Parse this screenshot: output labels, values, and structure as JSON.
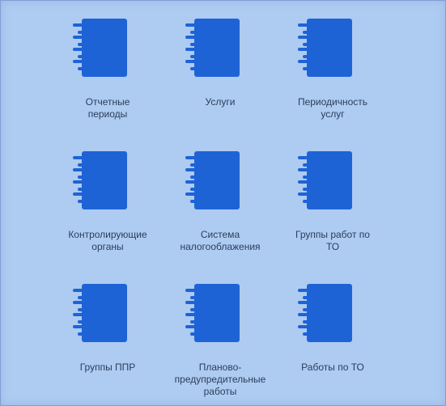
{
  "colors": {
    "background": "#aecbf1",
    "icon": "#1e63d6",
    "text": "#2a3e5c"
  },
  "tiles": [
    {
      "icon": "notebook-icon",
      "label": "Отчетные\nпериоды"
    },
    {
      "icon": "notebook-icon",
      "label": "Услуги"
    },
    {
      "icon": "notebook-icon",
      "label": "Периодичность\nуслуг"
    },
    {
      "icon": "notebook-icon",
      "label": "Контролирующие\nорганы"
    },
    {
      "icon": "notebook-icon",
      "label": "Система\nналогооблажения"
    },
    {
      "icon": "notebook-icon",
      "label": "Группы работ по\nТО"
    },
    {
      "icon": "notebook-icon",
      "label": "Группы ППР"
    },
    {
      "icon": "notebook-icon",
      "label": "Планово-\nпредупредительные\nработы"
    },
    {
      "icon": "notebook-icon",
      "label": "Работы по ТО"
    }
  ]
}
